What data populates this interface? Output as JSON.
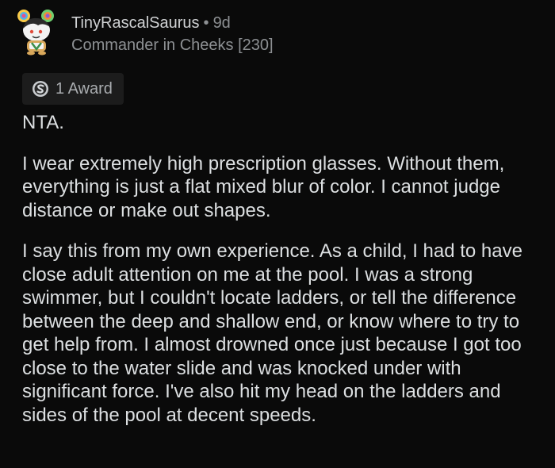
{
  "comment": {
    "username": "TinyRascalSaurus",
    "separator": "•",
    "age": "9d",
    "flair": "Commander in Cheeks [230]",
    "award": {
      "icon": "silver-award-icon",
      "label": "1 Award"
    },
    "paragraphs": [
      "NTA.",
      "I wear extremely high prescription glasses. Without them, everything is just a flat mixed blur of color. I cannot judge distance or make out shapes.",
      "I say this from my own experience. As a child, I had to have close adult attention on me at the pool. I was a strong swimmer, but I couldn't locate ladders, or tell the difference between the deep and shallow end, or know where to try to get help from. I almost drowned once just because I got too close to the water slide and was knocked under with significant force. I've also hit my head on the ladders and sides of the pool at decent speeds."
    ]
  },
  "colors": {
    "background": "#0a0a0a",
    "text": "#dcdfe1",
    "muted": "#8d9093",
    "chip": "#1c1c1c"
  }
}
